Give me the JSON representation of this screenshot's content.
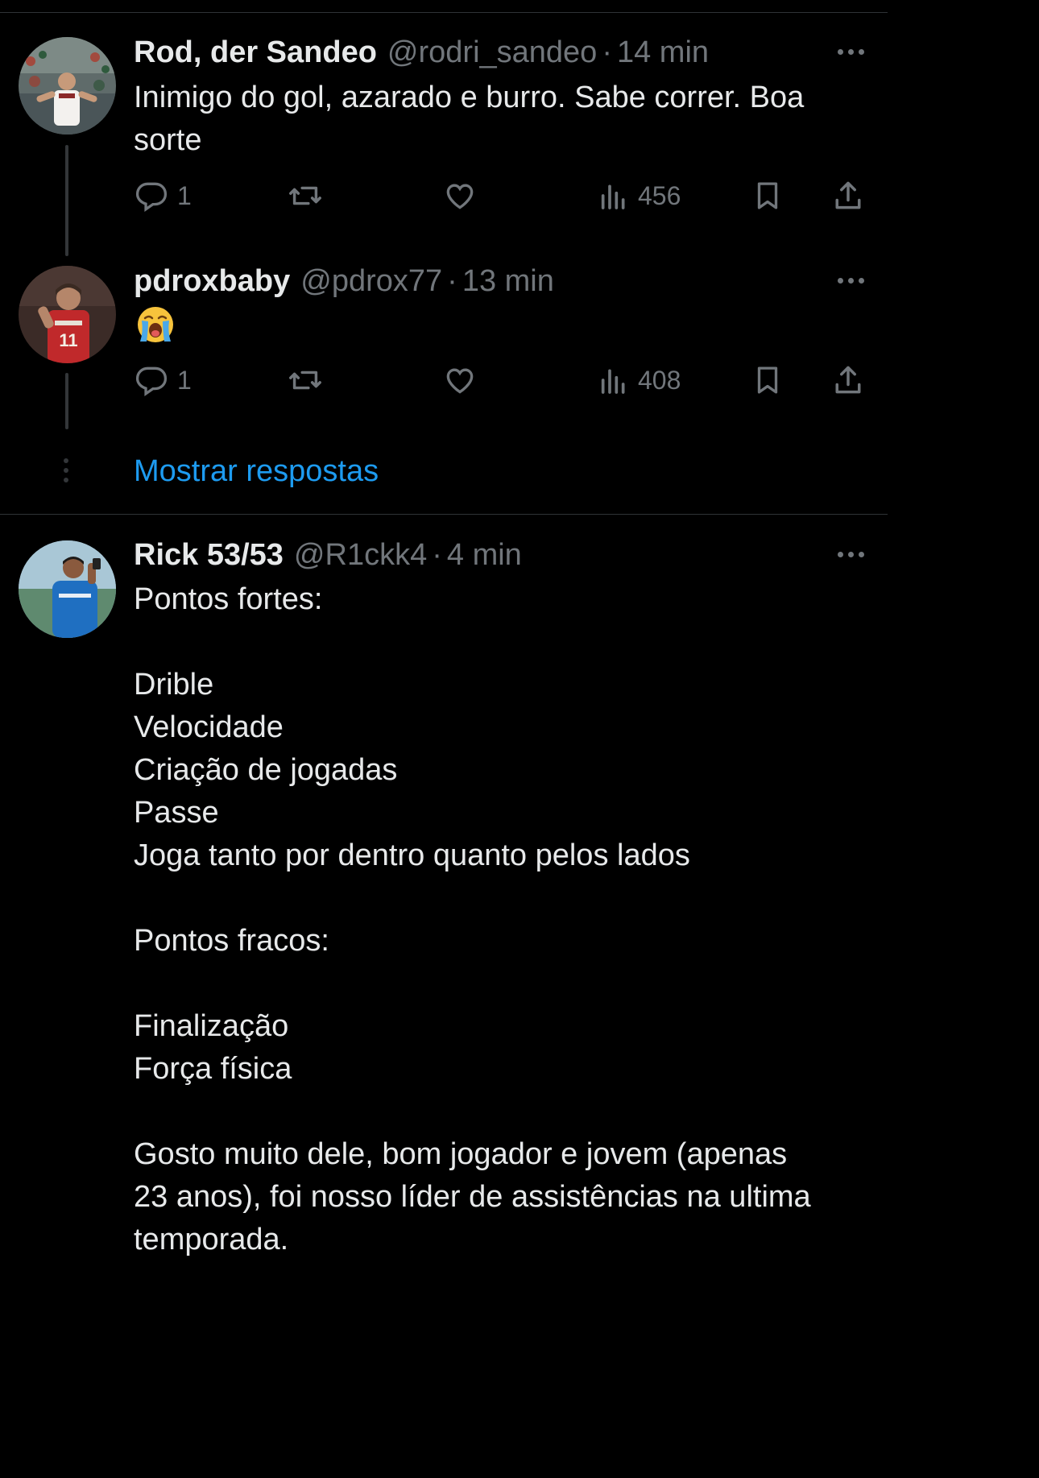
{
  "colors": {
    "background": "#000000",
    "text": "#e7e9ea",
    "secondary": "#71767b",
    "accent": "#1d9bf0",
    "divider": "#2f3336"
  },
  "tweets": [
    {
      "name": "Rod, der Sandeo",
      "handle": "@rodri_sandeo",
      "separator": "·",
      "time": "14 min",
      "text": "Inimigo do gol, azarado e burro. Sabe correr. Boa\nsorte",
      "replies": "1",
      "retweets": "",
      "likes": "",
      "views": "456",
      "avatar": "profile-photo-stadium-fan"
    },
    {
      "name": "pdroxbaby",
      "handle": "@pdrox77",
      "separator": "·",
      "time": "13 min",
      "emoji": "loudly-crying-face",
      "replies": "1",
      "retweets": "",
      "likes": "",
      "views": "408",
      "avatar": "profile-photo-red-jersey-11"
    },
    {
      "name": "Rick 53/53",
      "handle": "@R1ckk4",
      "separator": "·",
      "time": "4 min",
      "text": "Pontos fortes:\n\nDrible\nVelocidade\nCriação de jogadas\nPasse\nJoga tanto por dentro quanto pelos lados\n\nPontos fracos:\n\nFinalização\nForça física\n\nGosto muito dele, bom jogador e jovem (apenas\n23 anos), foi nosso líder de assistências na ultima\ntemporada.",
      "avatar": "profile-photo-blue-jersey-player"
    }
  ],
  "show_replies": "Mostrar respostas"
}
